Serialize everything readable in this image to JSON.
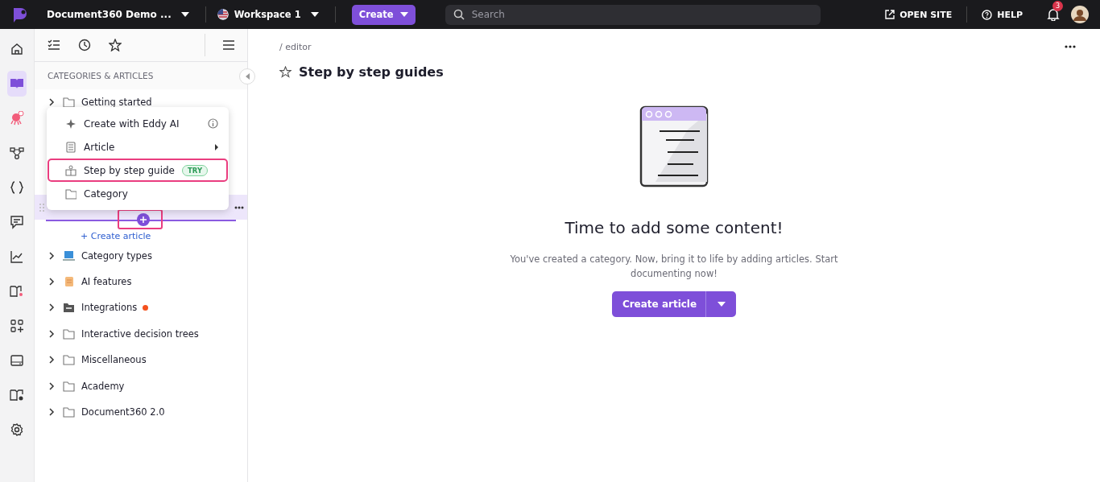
{
  "topbar": {
    "project": "Document360 Demo ...",
    "workspace": "Workspace 1",
    "create_button": "Create",
    "search": {
      "placeholder": "Search"
    },
    "open_site": "OPEN SITE",
    "help": "HELP",
    "notification_count": "3"
  },
  "rail": [
    {
      "kind": "home",
      "selected": false
    },
    {
      "kind": "book",
      "selected": true
    },
    {
      "kind": "bot",
      "selected": false
    },
    {
      "kind": "workflow",
      "selected": false
    },
    {
      "kind": "braces",
      "selected": false
    },
    {
      "kind": "chat",
      "selected": false
    },
    {
      "kind": "analytics",
      "selected": false
    },
    {
      "kind": "book-spark",
      "selected": false
    },
    {
      "kind": "apps",
      "selected": false
    },
    {
      "kind": "drive",
      "selected": false
    },
    {
      "kind": "book-gear",
      "selected": false
    },
    {
      "kind": "settings",
      "selected": false
    }
  ],
  "panel": {
    "section_title": "CATEGORIES & ARTICLES",
    "tree_top": [
      {
        "label": "Getting started",
        "kind": "folder"
      }
    ],
    "create_article": "+ Create article",
    "tree": [
      {
        "label": "Category types",
        "kind": "laptop"
      },
      {
        "label": "AI features",
        "kind": "scroll"
      },
      {
        "label": "Integrations",
        "kind": "dark-folder",
        "color": "#f4511e"
      },
      {
        "label": "Interactive decision trees",
        "kind": "folder"
      },
      {
        "label": "Miscellaneous",
        "kind": "folder"
      },
      {
        "label": "Academy",
        "kind": "folder"
      },
      {
        "label": "Document360 2.0",
        "kind": "folder"
      }
    ],
    "menu": [
      {
        "label": "Create with Eddy AI",
        "kind": "ai",
        "highlighted": false
      },
      {
        "label": "Article",
        "kind": "article",
        "highlighted": false
      },
      {
        "label": "Step by step guide",
        "kind": "guide",
        "badge": "TRY",
        "highlighted": true
      },
      {
        "label": "Category",
        "kind": "category",
        "highlighted": false
      }
    ]
  },
  "main": {
    "breadcrumb": "/ editor",
    "title": "Step by step guides",
    "empty_title": "Time to add some content!",
    "empty_message": "You've created a category. Now, bring it to life by adding articles. Start documenting now!",
    "button": "Create article"
  }
}
